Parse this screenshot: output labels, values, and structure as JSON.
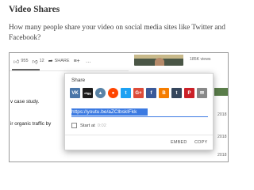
{
  "article": {
    "heading": "Video Shares",
    "question": "How many people share your video on social media sites like Twitter and Facebook?"
  },
  "player_actions": {
    "likes": "955",
    "dislikes": "12",
    "share_label": "SHARE",
    "more_label": "…"
  },
  "sidebar": {
    "views": "185K views",
    "side_snippets": [
      "on",
      "2018",
      "2018",
      "2018"
    ]
  },
  "page_fragments": [
    "v case study.",
    "ir organic traffic by"
  ],
  "share_dialog": {
    "title": "Share",
    "link": "https://youtu.be/aZClbskIFkk",
    "start_at_label": "Start at",
    "start_at_time": "0:02",
    "embed_label": "EMBED",
    "copy_label": "COPY",
    "networks": [
      {
        "name": "vk",
        "glyph": "VK",
        "color": "#4a76a8"
      },
      {
        "name": "digg",
        "glyph": "digg",
        "color": "#1b1b1b"
      },
      {
        "name": "myspace",
        "glyph": "▲",
        "color": "#5a83a6"
      },
      {
        "name": "reddit",
        "glyph": "●",
        "color": "#ff4500"
      },
      {
        "name": "twitter",
        "glyph": "t",
        "color": "#1da1f2"
      },
      {
        "name": "googleplus",
        "glyph": "G+",
        "color": "#dd4b39"
      },
      {
        "name": "facebook",
        "glyph": "f",
        "color": "#3b5998"
      },
      {
        "name": "blogger",
        "glyph": "B",
        "color": "#f57d00"
      },
      {
        "name": "tumblr",
        "glyph": "t",
        "color": "#35465c"
      },
      {
        "name": "pinterest",
        "glyph": "P",
        "color": "#cb2027"
      },
      {
        "name": "email",
        "glyph": "✉",
        "color": "#888888"
      }
    ]
  }
}
